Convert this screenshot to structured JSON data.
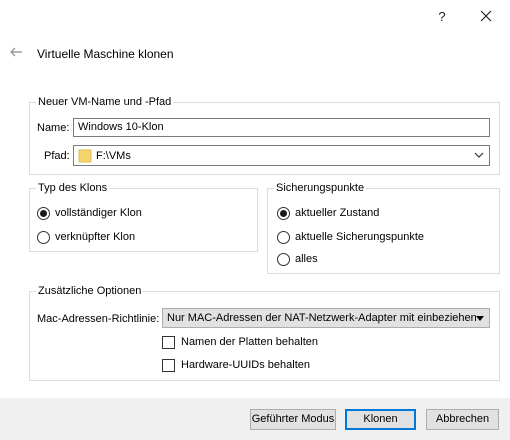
{
  "titlebar": {
    "help_glyph": "?",
    "close_glyph": "✕"
  },
  "dialog": {
    "title": "Virtuelle Maschine klonen"
  },
  "vm_name_group": {
    "legend": "Neuer VM-Name und -Pfad",
    "name_label": "Name:",
    "name_value": "Windows 10-Klon",
    "path_label": "Pfad:",
    "path_value": "F:\\VMs"
  },
  "clone_type_group": {
    "legend": "Typ des Klons",
    "options": [
      {
        "label": "vollständiger Klon",
        "selected": true
      },
      {
        "label": "verknüpfter Klon",
        "selected": false
      }
    ]
  },
  "snapshots_group": {
    "legend": "Sicherungspunkte",
    "options": [
      {
        "label": "aktueller Zustand",
        "selected": true
      },
      {
        "label": "aktuelle Sicherungspunkte",
        "selected": false
      },
      {
        "label": "alles",
        "selected": false
      }
    ]
  },
  "options_group": {
    "legend": "Zusätzliche Optionen",
    "mac_policy_label": "Mac-Adressen-Richtlinie:",
    "mac_policy_value": "Nur MAC-Adressen der NAT-Netzwerk-Adapter mit einbeziehen",
    "keep_disk_names_label": "Namen der Platten behalten",
    "keep_disk_names_checked": false,
    "keep_hw_uuids_label": "Hardware-UUIDs behalten",
    "keep_hw_uuids_checked": false
  },
  "footer": {
    "guided_mode_label": "Geführter Modus",
    "clone_label": "Klonen",
    "cancel_label": "Abbrechen"
  },
  "colors": {
    "accent": "#0078d7",
    "footer_bg": "#f0f0f0",
    "folder": "#f7d46b"
  },
  "icons": {
    "back": "back-arrow-icon",
    "folder": "folder-icon",
    "dropdown": "chevron-down-icon"
  }
}
